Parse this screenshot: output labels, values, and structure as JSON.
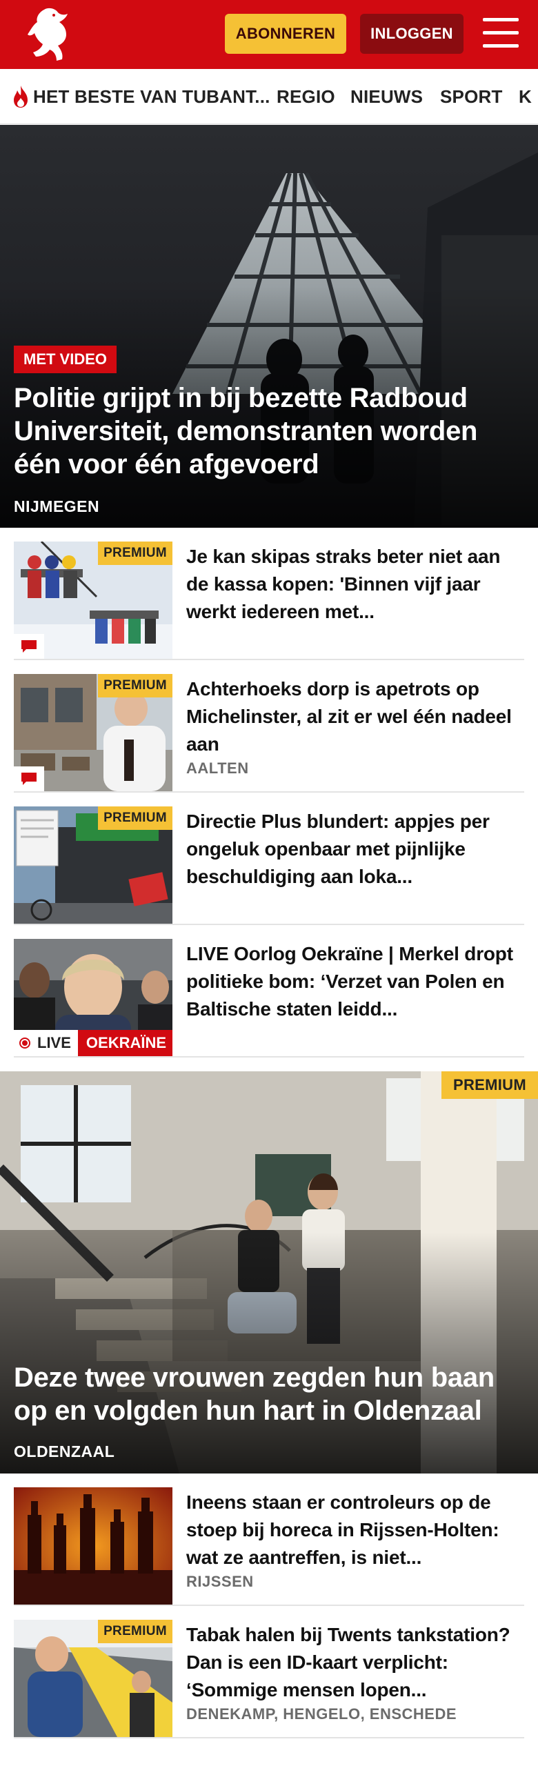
{
  "header": {
    "subscribe_label": "ABONNEREN",
    "login_label": "INLOGGEN",
    "logo_icon": "tubantia-horse-logo-icon",
    "menu_icon": "hamburger-menu-icon",
    "brand_color": "#d10a11",
    "accent_color": "#f5c135"
  },
  "nav": {
    "items": [
      {
        "label": "HET BESTE VAN TUBANT...",
        "icon": "flame-icon"
      },
      {
        "label": "REGIO"
      },
      {
        "label": "NIEUWS"
      },
      {
        "label": "SPORT"
      },
      {
        "label": "K"
      }
    ]
  },
  "hero1": {
    "badge": "MET VIDEO",
    "title": "Politie grijpt in bij bezette Radboud Universiteit, demonstranten worden één voor één afgevoerd",
    "location": "NIJMEGEN"
  },
  "articles1": [
    {
      "premium": "PREMIUM",
      "title": "Je kan skipas straks beter niet aan de kassa kopen: 'Binnen vijf jaar werkt iedereen met...",
      "location": "",
      "comment_icon": "comment-icon"
    },
    {
      "premium": "PREMIUM",
      "title": "Achterhoeks dorp is apetrots op Michelinster, al zit er wel één nadeel aan",
      "location": "AALTEN",
      "comment_icon": "comment-icon"
    },
    {
      "premium": "PREMIUM",
      "title": "Directie Plus blundert: appjes per ongeluk openbaar met pijnlijke beschuldiging aan loka...",
      "location": ""
    },
    {
      "title": "LIVE Oorlog Oekraïne | Merkel dropt politieke bom: ‘Verzet van Polen en Baltische staten leidd...",
      "live_label": "LIVE",
      "topic_label": "OEKRAÏNE"
    }
  ],
  "hero2": {
    "premium": "PREMIUM",
    "title": "Deze twee vrouwen zegden hun baan op en volgden hun hart in Oldenzaal",
    "location": "OLDENZAAL"
  },
  "articles2": [
    {
      "title": "Ineens staan er controleurs op de stoep bij horeca in Rijssen-Hol­ten: wat ze aantreffen, is niet...",
      "location": "RIJSSEN"
    },
    {
      "premium": "PREMIUM",
      "title": "Tabak halen bij Twents tankstati­on? Dan is een ID-kaart verplicht: ‘Sommige mensen lopen...",
      "location": "DENEKAMP, HENGELO, ENSCHEDE"
    }
  ]
}
